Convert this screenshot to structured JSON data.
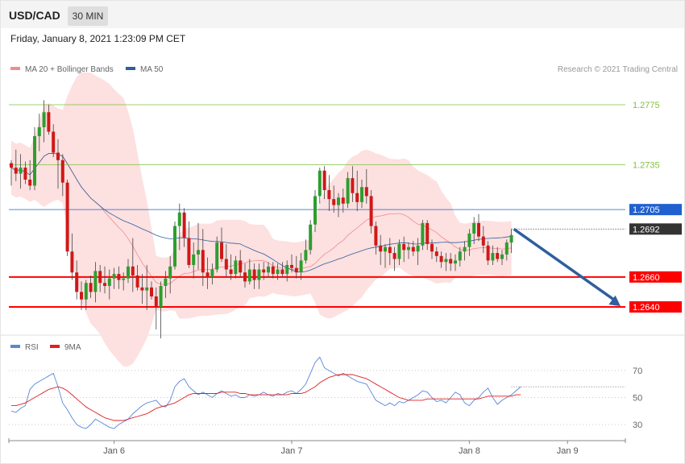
{
  "header": {
    "symbol": "USD/CAD",
    "timeframe": "30 MIN"
  },
  "datetime": "Friday, January 8, 2021 1:23:09 PM CET",
  "legend": {
    "main": [
      {
        "label": "MA 20 + Bollinger Bands",
        "color": "#f28b8b"
      },
      {
        "label": "MA 50",
        "color": "#2e5f9e"
      }
    ],
    "rsi": [
      {
        "label": "RSI",
        "color": "#5b86d6"
      },
      {
        "label": "9MA",
        "color": "#e02020"
      }
    ]
  },
  "credit": "Research © 2021 Trading Central",
  "chart_data": {
    "type": "candlestick",
    "price_range": [
      1.2615,
      1.28
    ],
    "levels": [
      {
        "label": "1.2775",
        "value": 1.2775,
        "color": "#7fc241",
        "style": "thin",
        "tag": "text"
      },
      {
        "label": "1.2735",
        "value": 1.2735,
        "color": "#7fc241",
        "style": "thin",
        "tag": "text"
      },
      {
        "label": "1.2705",
        "value": 1.2705,
        "color": "#2060d0",
        "style": "thin",
        "tag": "box"
      },
      {
        "label": "1.2660",
        "value": 1.266,
        "color": "#ff0000",
        "style": "thick",
        "tag": "box"
      },
      {
        "label": "1.2640",
        "value": 1.264,
        "color": "#ff0000",
        "style": "thick",
        "tag": "box"
      }
    ],
    "last_price": {
      "label": "1.2692",
      "value": 1.2692,
      "color": "#333333"
    },
    "projection": {
      "from": 1.2692,
      "to": 1.264,
      "color": "#2e5f9e"
    },
    "candles": [
      [
        1.2736,
        1.2738,
        1.2721,
        1.2733
      ],
      [
        1.2733,
        1.2745,
        1.2724,
        1.2729
      ],
      [
        1.2729,
        1.2742,
        1.2719,
        1.2733
      ],
      [
        1.2733,
        1.2737,
        1.2722,
        1.2725
      ],
      [
        1.2725,
        1.2738,
        1.2718,
        1.2721
      ],
      [
        1.2721,
        1.276,
        1.2718,
        1.2754
      ],
      [
        1.2754,
        1.2769,
        1.2744,
        1.276
      ],
      [
        1.276,
        1.2778,
        1.275,
        1.277
      ],
      [
        1.277,
        1.2775,
        1.2755,
        1.2757
      ],
      [
        1.2757,
        1.2762,
        1.274,
        1.2743
      ],
      [
        1.2743,
        1.2752,
        1.2719,
        1.2738
      ],
      [
        1.2738,
        1.2742,
        1.2714,
        1.2723
      ],
      [
        1.2723,
        1.2725,
        1.2674,
        1.2677
      ],
      [
        1.2677,
        1.2689,
        1.2658,
        1.2663
      ],
      [
        1.2663,
        1.2671,
        1.2645,
        1.265
      ],
      [
        1.265,
        1.2657,
        1.2638,
        1.2645
      ],
      [
        1.2645,
        1.2658,
        1.2638,
        1.2656
      ],
      [
        1.2656,
        1.2661,
        1.2646,
        1.265
      ],
      [
        1.265,
        1.267,
        1.2643,
        1.2664
      ],
      [
        1.2664,
        1.2668,
        1.265,
        1.2656
      ],
      [
        1.2656,
        1.2667,
        1.2649,
        1.2654
      ],
      [
        1.2654,
        1.2665,
        1.2645,
        1.2659
      ],
      [
        1.2659,
        1.2666,
        1.2652,
        1.2662
      ],
      [
        1.2662,
        1.2667,
        1.2652,
        1.2658
      ],
      [
        1.2658,
        1.2663,
        1.2651,
        1.2659
      ],
      [
        1.2659,
        1.2672,
        1.2656,
        1.2667
      ],
      [
        1.2667,
        1.2686,
        1.265,
        1.2661
      ],
      [
        1.2661,
        1.2668,
        1.2651,
        1.2653
      ],
      [
        1.2653,
        1.2662,
        1.2642,
        1.2651
      ],
      [
        1.2651,
        1.2668,
        1.2638,
        1.2653
      ],
      [
        1.2653,
        1.2657,
        1.2645,
        1.2647
      ],
      [
        1.2647,
        1.2653,
        1.2625,
        1.264
      ],
      [
        1.264,
        1.2657,
        1.2619,
        1.2654
      ],
      [
        1.2654,
        1.2664,
        1.2646,
        1.2659
      ],
      [
        1.2659,
        1.2674,
        1.2649,
        1.2667
      ],
      [
        1.2667,
        1.2697,
        1.2665,
        1.2694
      ],
      [
        1.2694,
        1.2709,
        1.2678,
        1.2703
      ],
      [
        1.2703,
        1.2706,
        1.268,
        1.2686
      ],
      [
        1.2686,
        1.2697,
        1.2666,
        1.2668
      ],
      [
        1.2668,
        1.2683,
        1.2659,
        1.2675
      ],
      [
        1.2675,
        1.2696,
        1.2665,
        1.2678
      ],
      [
        1.2678,
        1.2692,
        1.2654,
        1.2663
      ],
      [
        1.2663,
        1.2673,
        1.2652,
        1.266
      ],
      [
        1.266,
        1.2669,
        1.2655,
        1.2665
      ],
      [
        1.2665,
        1.2687,
        1.2663,
        1.2683
      ],
      [
        1.2683,
        1.2693,
        1.267,
        1.2672
      ],
      [
        1.2672,
        1.2682,
        1.266,
        1.2665
      ],
      [
        1.2665,
        1.2675,
        1.2658,
        1.2662
      ],
      [
        1.2662,
        1.2674,
        1.2659,
        1.2671
      ],
      [
        1.2671,
        1.2678,
        1.266,
        1.2663
      ],
      [
        1.2663,
        1.2669,
        1.2653,
        1.2657
      ],
      [
        1.2657,
        1.2672,
        1.2655,
        1.2665
      ],
      [
        1.2665,
        1.2669,
        1.2652,
        1.2658
      ],
      [
        1.2658,
        1.2669,
        1.2652,
        1.2665
      ],
      [
        1.2665,
        1.267,
        1.2658,
        1.2663
      ],
      [
        1.2663,
        1.267,
        1.266,
        1.2667
      ],
      [
        1.2667,
        1.267,
        1.2659,
        1.2662
      ],
      [
        1.2662,
        1.2669,
        1.2658,
        1.2665
      ],
      [
        1.2665,
        1.267,
        1.266,
        1.2662
      ],
      [
        1.2662,
        1.2671,
        1.2657,
        1.2668
      ],
      [
        1.2668,
        1.2675,
        1.2663,
        1.2666
      ],
      [
        1.2666,
        1.2674,
        1.2659,
        1.2663
      ],
      [
        1.2663,
        1.2676,
        1.2658,
        1.2671
      ],
      [
        1.2671,
        1.2685,
        1.2669,
        1.2678
      ],
      [
        1.2678,
        1.2698,
        1.2675,
        1.2695
      ],
      [
        1.2695,
        1.2718,
        1.269,
        1.2714
      ],
      [
        1.2714,
        1.2733,
        1.2709,
        1.2731
      ],
      [
        1.2731,
        1.2734,
        1.2712,
        1.2718
      ],
      [
        1.2718,
        1.2728,
        1.2704,
        1.2712
      ],
      [
        1.2712,
        1.2721,
        1.2703,
        1.2708
      ],
      [
        1.2708,
        1.2716,
        1.27,
        1.2713
      ],
      [
        1.2713,
        1.2719,
        1.2703,
        1.2709
      ],
      [
        1.2709,
        1.273,
        1.2706,
        1.2726
      ],
      [
        1.2726,
        1.2734,
        1.271,
        1.2716
      ],
      [
        1.2716,
        1.2731,
        1.2704,
        1.271
      ],
      [
        1.271,
        1.2725,
        1.2706,
        1.272
      ],
      [
        1.272,
        1.2732,
        1.2709,
        1.2714
      ],
      [
        1.2714,
        1.2718,
        1.2689,
        1.2694
      ],
      [
        1.2694,
        1.2697,
        1.2675,
        1.2681
      ],
      [
        1.2681,
        1.2688,
        1.2668,
        1.2677
      ],
      [
        1.2677,
        1.2682,
        1.2666,
        1.268
      ],
      [
        1.268,
        1.2686,
        1.2668,
        1.2676
      ],
      [
        1.2676,
        1.268,
        1.2664,
        1.2672
      ],
      [
        1.2672,
        1.2685,
        1.2668,
        1.2682
      ],
      [
        1.2682,
        1.2687,
        1.267,
        1.2678
      ],
      [
        1.2678,
        1.2683,
        1.2672,
        1.268
      ],
      [
        1.268,
        1.2684,
        1.2674,
        1.2677
      ],
      [
        1.2677,
        1.2686,
        1.2668,
        1.2681
      ],
      [
        1.2681,
        1.2698,
        1.2678,
        1.2696
      ],
      [
        1.2696,
        1.2698,
        1.2678,
        1.2682
      ],
      [
        1.2682,
        1.2685,
        1.2672,
        1.2677
      ],
      [
        1.2677,
        1.268,
        1.267,
        1.2674
      ],
      [
        1.2674,
        1.2677,
        1.2666,
        1.267
      ],
      [
        1.267,
        1.2676,
        1.2664,
        1.2672
      ],
      [
        1.2672,
        1.2676,
        1.2664,
        1.2669
      ],
      [
        1.2669,
        1.2675,
        1.2664,
        1.2671
      ],
      [
        1.2671,
        1.268,
        1.2667,
        1.2677
      ],
      [
        1.2677,
        1.2684,
        1.2671,
        1.268
      ],
      [
        1.268,
        1.2692,
        1.2674,
        1.2689
      ],
      [
        1.2689,
        1.27,
        1.2682,
        1.2696
      ],
      [
        1.2696,
        1.2702,
        1.2684,
        1.2687
      ],
      [
        1.2687,
        1.2694,
        1.2676,
        1.2681
      ],
      [
        1.2681,
        1.2684,
        1.2668,
        1.2671
      ],
      [
        1.2671,
        1.2681,
        1.2668,
        1.2676
      ],
      [
        1.2676,
        1.268,
        1.267,
        1.2672
      ],
      [
        1.2672,
        1.2678,
        1.2668,
        1.2675
      ],
      [
        1.2675,
        1.2685,
        1.2671,
        1.2683
      ],
      [
        1.2683,
        1.2692,
        1.2676,
        1.2688
      ]
    ],
    "x_ticks": [
      {
        "label": "Jan 6",
        "index": 22
      },
      {
        "label": "Jan 7",
        "index": 60
      },
      {
        "label": "Jan 8",
        "index": 98
      },
      {
        "label": "Jan 9",
        "index": 119
      }
    ],
    "rsi": {
      "range": [
        15,
        85
      ],
      "levels": [
        70,
        50,
        30
      ],
      "tick_labels": [
        "70",
        "50",
        "30"
      ],
      "values": [
        40,
        39,
        42,
        44,
        56,
        60,
        62,
        64,
        66,
        68,
        58,
        46,
        41,
        35,
        30,
        28,
        27,
        30,
        34,
        32,
        30,
        28,
        27,
        30,
        32,
        34,
        38,
        41,
        44,
        46,
        47,
        48,
        44,
        43,
        48,
        58,
        62,
        64,
        58,
        55,
        52,
        54,
        52,
        50,
        53,
        55,
        53,
        51,
        52,
        50,
        50,
        52,
        51,
        52,
        54,
        52,
        51,
        53,
        52,
        54,
        55,
        53,
        56,
        60,
        68,
        76,
        80,
        72,
        70,
        68,
        66,
        68,
        66,
        64,
        62,
        61,
        60,
        54,
        48,
        46,
        44,
        46,
        44,
        47,
        46,
        48,
        50,
        52,
        55,
        54,
        50,
        47,
        48,
        46,
        50,
        54,
        52,
        46,
        44,
        48,
        50,
        54,
        57,
        50,
        45,
        48,
        50,
        52,
        55,
        58
      ],
      "ma": [
        44,
        44,
        45,
        46,
        48,
        50,
        52,
        54,
        56,
        57,
        58,
        57,
        55,
        52,
        49,
        46,
        43,
        41,
        39,
        37,
        35,
        34,
        33,
        33,
        33,
        34,
        35,
        36,
        37,
        38,
        40,
        42,
        43,
        44,
        45,
        46,
        48,
        50,
        52,
        53,
        53,
        53,
        53,
        53,
        53,
        54,
        54,
        54,
        54,
        53,
        53,
        52,
        52,
        52,
        52,
        52,
        52,
        52,
        52,
        52,
        53,
        53,
        53,
        54,
        56,
        58,
        61,
        63,
        65,
        66,
        67,
        67,
        67,
        67,
        66,
        65,
        64,
        62,
        60,
        58,
        56,
        54,
        52,
        50,
        49,
        48,
        48,
        48,
        48,
        49,
        49,
        49,
        49,
        49,
        49,
        49,
        49,
        49,
        49,
        49,
        49,
        50,
        51,
        51,
        51,
        51,
        51,
        51,
        52,
        52
      ]
    }
  }
}
